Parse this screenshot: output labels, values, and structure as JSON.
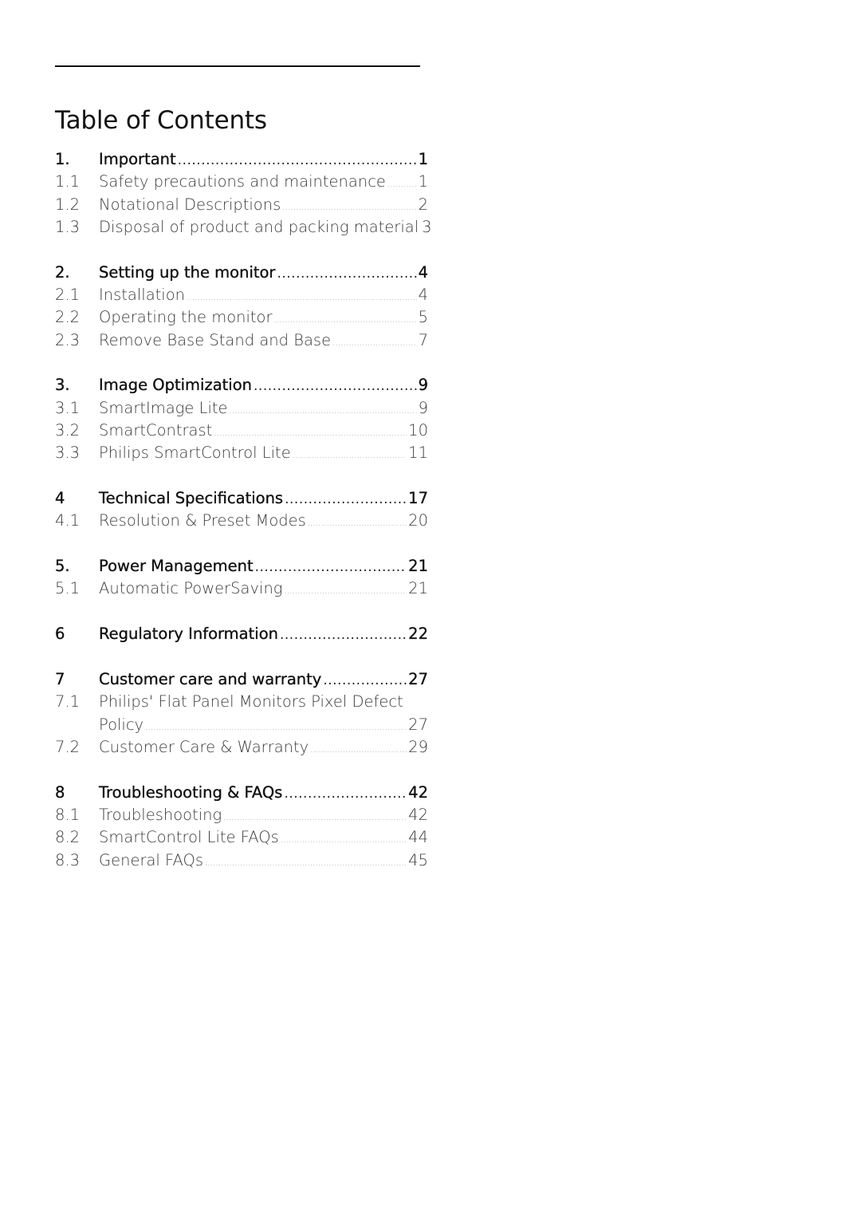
{
  "document": {
    "title": "Table of Contents",
    "sections": [
      {
        "number": "1.",
        "title": "Important",
        "page": "1",
        "subsections": [
          {
            "number": "1.1",
            "title": "Safety precautions and maintenance",
            "page": "1"
          },
          {
            "number": "1.2",
            "title": "Notational Descriptions",
            "page": "2"
          },
          {
            "number": "1.3",
            "title": "Disposal of product and packing material",
            "page": "3"
          }
        ]
      },
      {
        "number": "2.",
        "title": "Setting up the monitor",
        "page": "4",
        "subsections": [
          {
            "number": "2.1",
            "title": "Installation",
            "page": "4"
          },
          {
            "number": "2.2",
            "title": "Operating the monitor",
            "page": "5"
          },
          {
            "number": "2.3",
            "title": "Remove Base Stand and Base",
            "page": "7"
          }
        ]
      },
      {
        "number": "3.",
        "title": "Image Optimization",
        "page": "9",
        "subsections": [
          {
            "number": "3.1",
            "title": "SmartImage Lite",
            "page": "9"
          },
          {
            "number": "3.2",
            "title": "SmartContrast",
            "page": "10"
          },
          {
            "number": "3.3",
            "title": "Philips SmartControl Lite",
            "page": "11"
          }
        ]
      },
      {
        "number": "4",
        "title": "Technical Specifications",
        "page": "17",
        "subsections": [
          {
            "number": "4.1",
            "title": "Resolution & Preset Modes",
            "page": "20"
          }
        ]
      },
      {
        "number": "5.",
        "title": "Power Management",
        "page": "21",
        "subsections": [
          {
            "number": "5.1",
            "title": "Automatic PowerSaving",
            "page": "21"
          }
        ]
      },
      {
        "number": "6",
        "title": "Regulatory Information",
        "page": "22",
        "subsections": []
      },
      {
        "number": "7",
        "title": "Customer care and warranty",
        "page": "27",
        "subsections": [
          {
            "number": "7.1",
            "title": "Philips' Flat Panel Monitors Pixel Defect",
            "title_cont": "Policy",
            "page": "27"
          },
          {
            "number": "7.2",
            "title": "Customer Care & Warranty",
            "page": "29"
          }
        ]
      },
      {
        "number": "8",
        "title": "Troubleshooting & FAQs",
        "page": "42",
        "subsections": [
          {
            "number": "8.1",
            "title": "Troubleshooting",
            "page": "42"
          },
          {
            "number": "8.2",
            "title": "SmartControl Lite FAQs",
            "page": "44"
          },
          {
            "number": "8.3",
            "title": "General FAQs",
            "page": "45"
          }
        ]
      }
    ]
  }
}
